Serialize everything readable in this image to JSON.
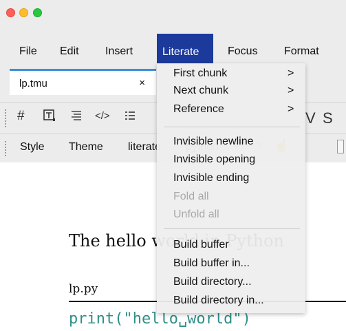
{
  "menubar": {
    "items": [
      "File",
      "Edit",
      "Insert",
      "Literate",
      "Focus",
      "Format"
    ],
    "active_index": 3
  },
  "tab": {
    "label": "lp.tmu",
    "close": "×"
  },
  "toolbar": {
    "partial_v": "V",
    "s_glyph": "S"
  },
  "format_bar": {
    "items": [
      "Style",
      "Theme",
      "literate",
      "python"
    ]
  },
  "dropdown": {
    "items": [
      {
        "label": "First chunk",
        "arrow": ">"
      },
      {
        "label": "Next chunk",
        "arrow": ">"
      },
      {
        "label": "Reference",
        "arrow": ">"
      },
      {
        "label": "Invisible newline"
      },
      {
        "label": "Invisible opening"
      },
      {
        "label": "Invisible ending"
      },
      {
        "label": "Fold all",
        "disabled": true
      },
      {
        "label": "Unfold all",
        "disabled": true
      },
      {
        "label": "Build buffer"
      },
      {
        "label": "Build buffer in..."
      },
      {
        "label": "Build directory..."
      },
      {
        "label": "Build directory in..."
      }
    ]
  },
  "document": {
    "title": "The hello world in Python",
    "filename": "lp.py",
    "code": "print(\"hello␣world\")"
  },
  "colors": {
    "menu_highlight": "#1b3a9c",
    "tab_accent": "#3d8ed8",
    "code_text": "#2f8f88"
  }
}
